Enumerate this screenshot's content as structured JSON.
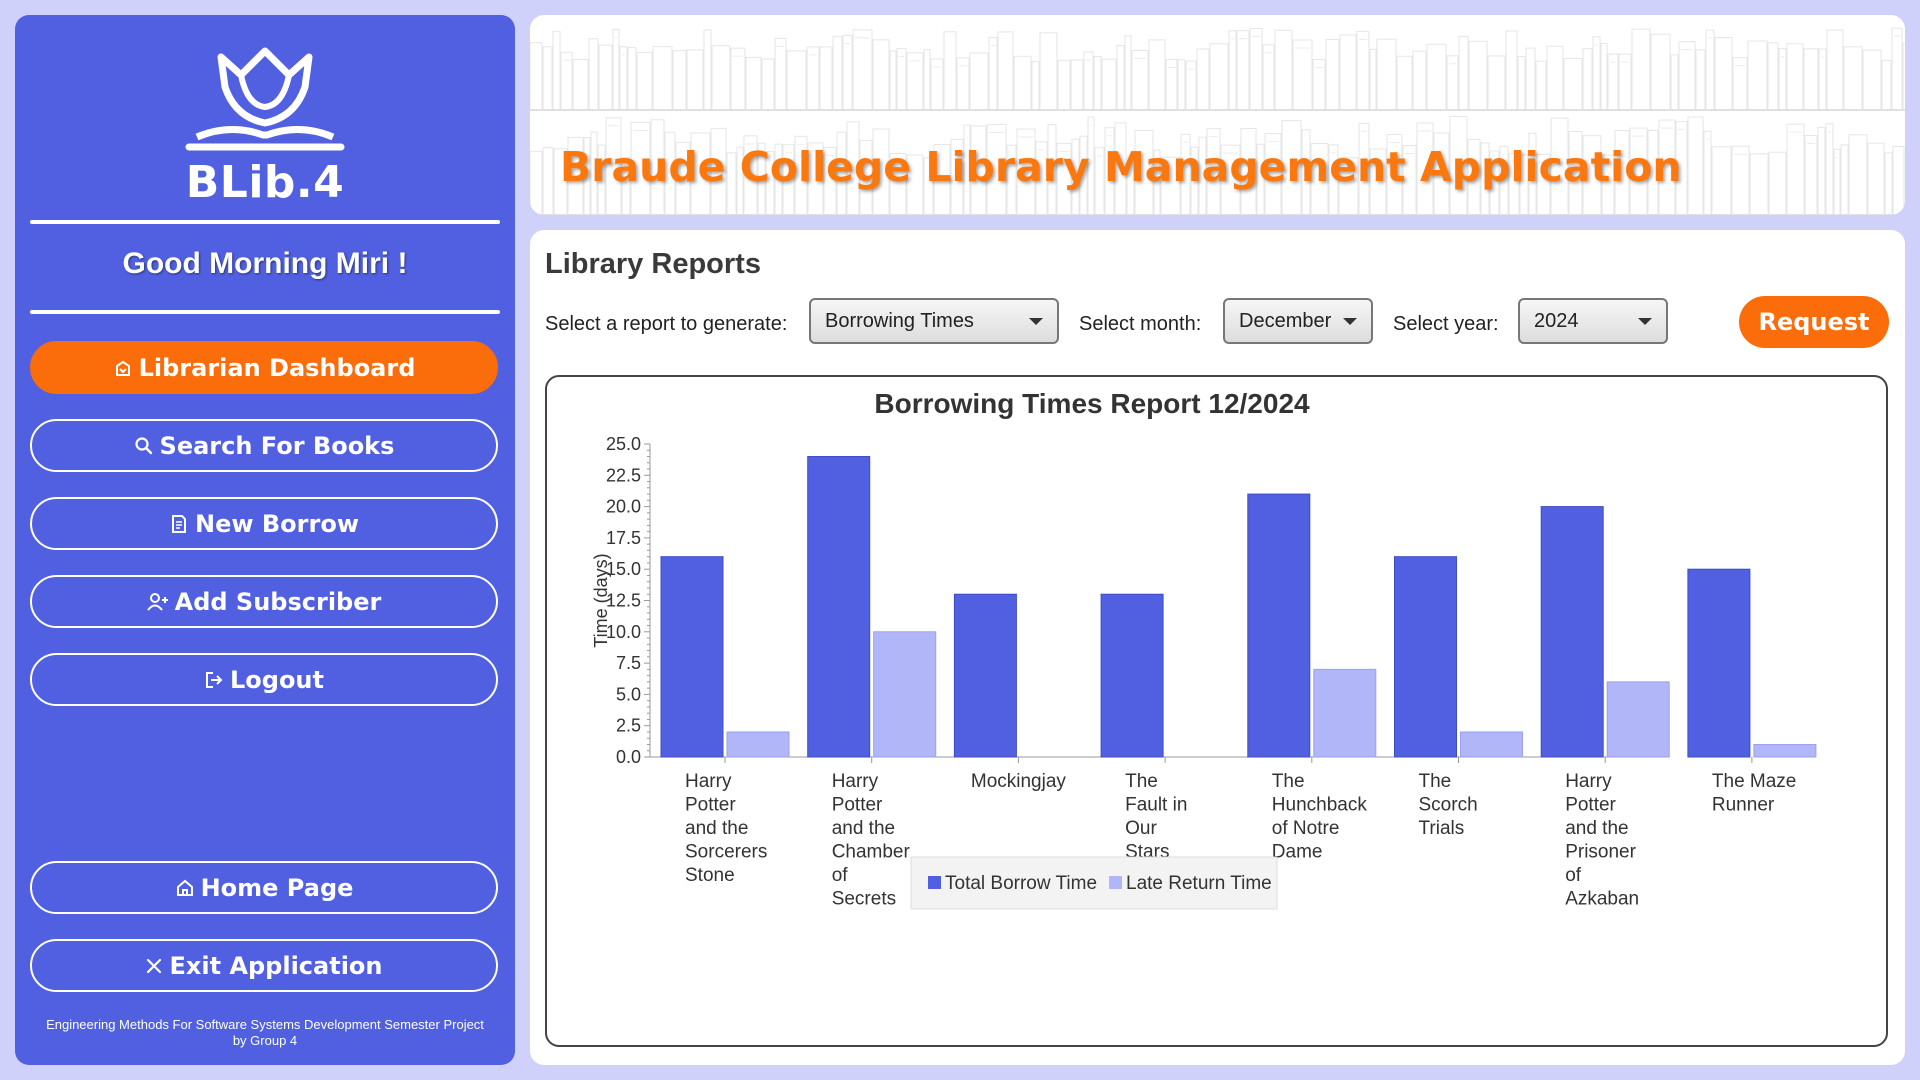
{
  "sidebar": {
    "logo_text": "BLib.4",
    "greeting": "Good Morning Miri !",
    "nav": [
      {
        "label": "Librarian Dashboard",
        "icon": "dashboard-icon",
        "active": true
      },
      {
        "label": "Search For Books",
        "icon": "search-icon"
      },
      {
        "label": "New Borrow",
        "icon": "document-icon"
      },
      {
        "label": "Add Subscriber",
        "icon": "add-user-icon"
      },
      {
        "label": "Logout",
        "icon": "logout-icon"
      }
    ],
    "bottom_nav": [
      {
        "label": "Home Page",
        "icon": "home-icon"
      },
      {
        "label": "Exit Application",
        "icon": "close-icon"
      }
    ],
    "footer_line1": "Engineering Methods For Software Systems Development Semester Project",
    "footer_line2": "by Group 4"
  },
  "banner": {
    "title": "Braude College Library Management Application"
  },
  "reports": {
    "title": "Library Reports",
    "report_label": "Select a report to generate:",
    "report_value": "Borrowing Times",
    "month_label": "Select month:",
    "month_value": "December",
    "year_label": "Select year:",
    "year_value": "2024",
    "request_label": "Request"
  },
  "colors": {
    "primary": "#5060e0",
    "accent": "#fb6c0a",
    "late": "#b0b6f8"
  },
  "chart_data": {
    "type": "bar",
    "title": "Borrowing Times Report 12/2024",
    "ylabel": "Time (days)",
    "xlabel": "",
    "ylim": [
      0,
      25
    ],
    "yticks": [
      "0.0",
      "2.5",
      "5.0",
      "7.5",
      "10.0",
      "12.5",
      "15.0",
      "17.5",
      "20.0",
      "22.5",
      "25.0"
    ],
    "categories": [
      [
        "Harry",
        "Potter",
        "and the",
        "Sorcerers",
        "Stone"
      ],
      [
        "Harry",
        "Potter",
        "and the",
        "Chamber",
        "of",
        "Secrets"
      ],
      [
        "Mockingjay"
      ],
      [
        "The",
        "Fault in",
        "Our",
        "Stars"
      ],
      [
        "The",
        "Hunchback",
        "of Notre",
        "Dame"
      ],
      [
        "The",
        "Scorch",
        "Trials"
      ],
      [
        "Harry",
        "Potter",
        "and the",
        "Prisoner",
        "of",
        "Azkaban"
      ],
      [
        "The Maze",
        "Runner"
      ]
    ],
    "series": [
      {
        "name": "Total Borrow Time",
        "color": "#5060e0",
        "values": [
          16,
          24,
          13,
          13,
          21,
          16,
          20,
          15
        ]
      },
      {
        "name": "Late Return Time",
        "color": "#b0b6f8",
        "values": [
          2,
          10,
          0,
          0,
          7,
          2,
          6,
          1
        ]
      }
    ],
    "legend": "bottom"
  }
}
